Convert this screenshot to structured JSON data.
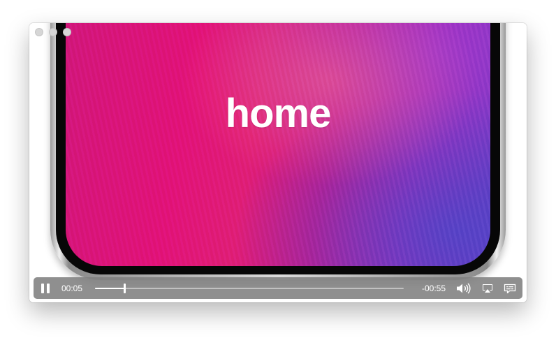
{
  "window": {
    "traffic_lights": [
      "close",
      "minimize",
      "zoom"
    ]
  },
  "video": {
    "caption": "home",
    "colors": {
      "screen_pink": "#e2137a",
      "screen_purple": "#6d3cc4",
      "controls_bg": "#808080"
    }
  },
  "controls": {
    "current_time": "00:05",
    "remaining_time": "-00:55",
    "progress_fraction": 0.095,
    "icons": [
      "pause-icon",
      "volume-icon",
      "airplay-icon",
      "subtitles-icon"
    ]
  }
}
